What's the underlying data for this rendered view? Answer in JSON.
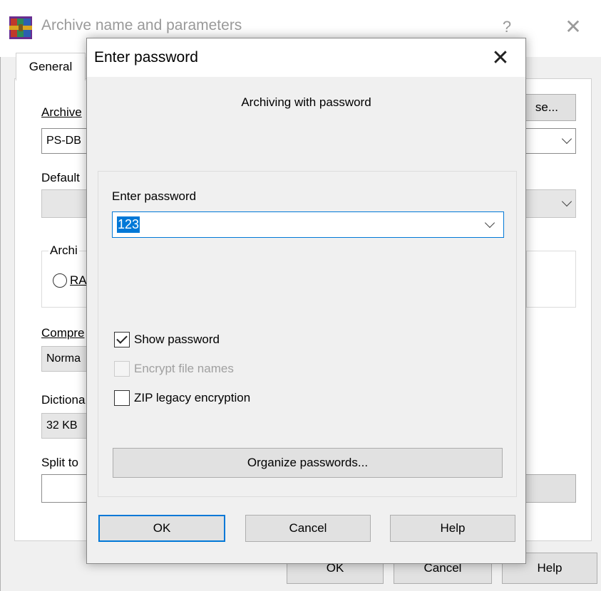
{
  "background_window": {
    "title": "Archive name and parameters",
    "help_glyph": "?",
    "close_glyph": "✕",
    "tab_general": "General",
    "archive_label_fragment": "Archive",
    "archive_name_fragment": "PS-DB",
    "browse_fragment": "se...",
    "default_label_fragment": "Default",
    "archive_format_fragment": "Archi",
    "radio_label_fragment": "RA",
    "compression_label_fragment": "Compre",
    "compression_value_fragment": "Norma",
    "dictionary_label_fragment": "Dictiona",
    "dictionary_value_fragment": "32 KB",
    "split_label_fragment": "Split to",
    "ok_label": "OK",
    "cancel_label": "Cancel",
    "help_label": "Help"
  },
  "dialog": {
    "title": "Enter password",
    "close_glyph": "✕",
    "heading": "Archiving with password",
    "password_label": "Enter password",
    "password_value": "123",
    "checkboxes": [
      {
        "label": "Show password",
        "checked": true,
        "enabled": true
      },
      {
        "label": "Encrypt file names",
        "checked": false,
        "enabled": false
      },
      {
        "label": "ZIP legacy encryption",
        "checked": false,
        "enabled": true
      }
    ],
    "organize_label": "Organize passwords...",
    "ok_label": "OK",
    "cancel_label": "Cancel",
    "help_label": "Help"
  },
  "colors": {
    "focus_accent": "#0078d7",
    "dialog_background": "#f0f0f0"
  },
  "icons": [
    "winrar-app-icon",
    "help-icon",
    "close-icon",
    "chevron-down-icon",
    "checkmark-icon"
  ]
}
